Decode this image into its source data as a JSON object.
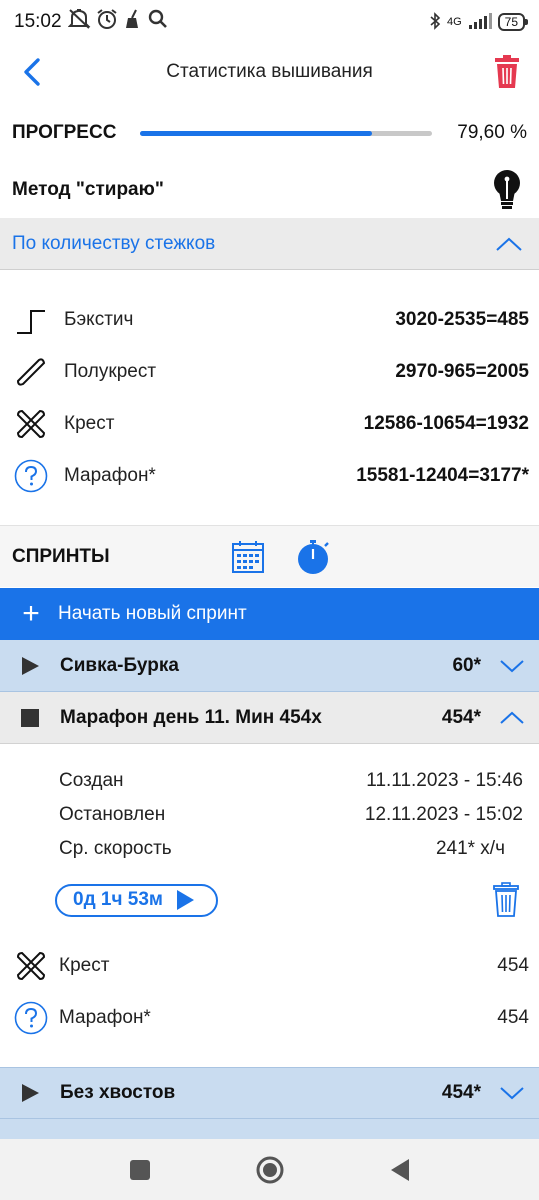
{
  "status_bar": {
    "time": "15:02",
    "network": "4G",
    "battery": "75",
    "icons": [
      "mute-icon",
      "alarm-icon",
      "broom-icon",
      "search-icon",
      "bluetooth-icon",
      "signal-icon",
      "battery-icon"
    ]
  },
  "app_bar": {
    "title": "Статистика вышивания",
    "back_icon": "chevron-left-icon",
    "delete_icon": "trash-icon"
  },
  "progress": {
    "label": "ПРОГРЕСС",
    "value_text": "79,60 %",
    "fraction": 0.796
  },
  "method": {
    "label": "Метод \"стираю\"",
    "icon": "lightbulb-icon"
  },
  "stitch_section": {
    "title": "По количеству стежков",
    "items": [
      {
        "name": "Бэкстич",
        "value": "3020-2535=485",
        "icon": "backstitch-icon"
      },
      {
        "name": "Полукрест",
        "value": "2970-965=2005",
        "icon": "half-cross-icon"
      },
      {
        "name": "Крест",
        "value": "12586-10654=1932",
        "icon": "cross-stitch-icon"
      },
      {
        "name": "Марафон*",
        "value": "15581-12404=3177*",
        "icon": "question-icon"
      }
    ]
  },
  "sprints": {
    "title": "СПРИНТЫ",
    "new_sprint_label": "Начать новый спринт",
    "list": [
      {
        "name": "Сивка-Бурка",
        "count": "60*",
        "state": "play"
      },
      {
        "name": "Марафон день 11. Мин 454х",
        "count": "454*",
        "state": "stop"
      },
      {
        "name": "Без хвостов",
        "count": "454*",
        "state": "play"
      }
    ],
    "expanded": {
      "created_label": "Создан",
      "created_value": "11.11.2023 - 15:46",
      "stopped_label": "Остановлен",
      "stopped_value": "12.11.2023 - 15:02",
      "speed_label": "Ср. скорость",
      "speed_value": "241* х/ч",
      "timer": "0д 1ч 53м",
      "items": [
        {
          "name": "Крест",
          "value": "454",
          "icon": "cross-stitch-icon"
        },
        {
          "name": "Марафон*",
          "value": "454",
          "icon": "question-icon"
        }
      ]
    }
  },
  "colors": {
    "accent": "#1a73e8",
    "delete_red": "#e53950",
    "sprint_row_bg": "#c9dcf0",
    "section_bg": "#ebebeb"
  }
}
